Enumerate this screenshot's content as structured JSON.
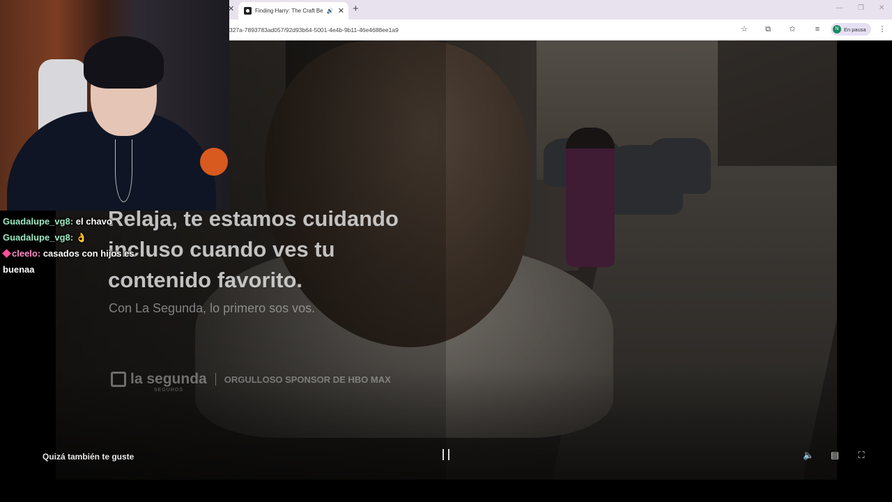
{
  "browser": {
    "tab_title": "Finding Harry: The Craft Be",
    "url": "327a-7893783ad057/92d93b64-5001-4e4b-9b11-46e4688ee1a9",
    "profile_initial": "N",
    "profile_label": "En pausa"
  },
  "ad": {
    "heading": "Relaja, te estamos cuidando incluso cuando ves tu contenido favorito.",
    "subtext": "Con La Segunda, lo primero sos vos.",
    "brand_name": "la segunda",
    "brand_small": "SEGUROS",
    "brand_tag": "ORGULLOSO SPONSOR DE HBO MAX"
  },
  "controls": {
    "recommend_label": "Quizá también te guste"
  },
  "chat": [
    {
      "user": "Guadalupe_vg8",
      "sep": ":",
      "text": "el chavo",
      "color": "#9ce8c2"
    },
    {
      "user": "Guadalupe_vg8",
      "sep": ":",
      "text": "👌",
      "color": "#9ce8c2"
    },
    {
      "user": "cleelo",
      "sep": ":",
      "text": "casados con hijos es buenaa",
      "color": "#ff8fc7"
    }
  ],
  "icons": [
    "close-icon",
    "speaker-icon",
    "plus-icon",
    "star-icon",
    "extensions-icon",
    "bookmark-icon",
    "media-icon",
    "menu-icon",
    "cast-icon",
    "pause-icon",
    "volume-icon",
    "subtitles-icon",
    "fullscreen-icon"
  ]
}
